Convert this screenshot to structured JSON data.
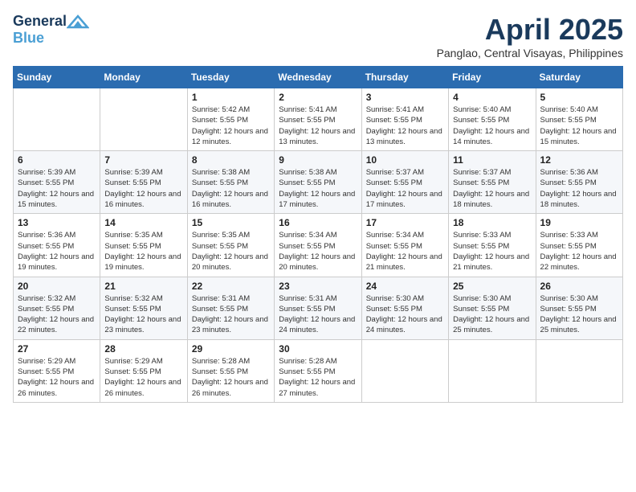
{
  "header": {
    "logo_line1": "General",
    "logo_line2": "Blue",
    "month_title": "April 2025",
    "location": "Panglao, Central Visayas, Philippines"
  },
  "weekdays": [
    "Sunday",
    "Monday",
    "Tuesday",
    "Wednesday",
    "Thursday",
    "Friday",
    "Saturday"
  ],
  "weeks": [
    [
      {
        "day": null,
        "info": null
      },
      {
        "day": null,
        "info": null
      },
      {
        "day": "1",
        "info": "Sunrise: 5:42 AM\nSunset: 5:55 PM\nDaylight: 12 hours and 12 minutes."
      },
      {
        "day": "2",
        "info": "Sunrise: 5:41 AM\nSunset: 5:55 PM\nDaylight: 12 hours and 13 minutes."
      },
      {
        "day": "3",
        "info": "Sunrise: 5:41 AM\nSunset: 5:55 PM\nDaylight: 12 hours and 13 minutes."
      },
      {
        "day": "4",
        "info": "Sunrise: 5:40 AM\nSunset: 5:55 PM\nDaylight: 12 hours and 14 minutes."
      },
      {
        "day": "5",
        "info": "Sunrise: 5:40 AM\nSunset: 5:55 PM\nDaylight: 12 hours and 15 minutes."
      }
    ],
    [
      {
        "day": "6",
        "info": "Sunrise: 5:39 AM\nSunset: 5:55 PM\nDaylight: 12 hours and 15 minutes."
      },
      {
        "day": "7",
        "info": "Sunrise: 5:39 AM\nSunset: 5:55 PM\nDaylight: 12 hours and 16 minutes."
      },
      {
        "day": "8",
        "info": "Sunrise: 5:38 AM\nSunset: 5:55 PM\nDaylight: 12 hours and 16 minutes."
      },
      {
        "day": "9",
        "info": "Sunrise: 5:38 AM\nSunset: 5:55 PM\nDaylight: 12 hours and 17 minutes."
      },
      {
        "day": "10",
        "info": "Sunrise: 5:37 AM\nSunset: 5:55 PM\nDaylight: 12 hours and 17 minutes."
      },
      {
        "day": "11",
        "info": "Sunrise: 5:37 AM\nSunset: 5:55 PM\nDaylight: 12 hours and 18 minutes."
      },
      {
        "day": "12",
        "info": "Sunrise: 5:36 AM\nSunset: 5:55 PM\nDaylight: 12 hours and 18 minutes."
      }
    ],
    [
      {
        "day": "13",
        "info": "Sunrise: 5:36 AM\nSunset: 5:55 PM\nDaylight: 12 hours and 19 minutes."
      },
      {
        "day": "14",
        "info": "Sunrise: 5:35 AM\nSunset: 5:55 PM\nDaylight: 12 hours and 19 minutes."
      },
      {
        "day": "15",
        "info": "Sunrise: 5:35 AM\nSunset: 5:55 PM\nDaylight: 12 hours and 20 minutes."
      },
      {
        "day": "16",
        "info": "Sunrise: 5:34 AM\nSunset: 5:55 PM\nDaylight: 12 hours and 20 minutes."
      },
      {
        "day": "17",
        "info": "Sunrise: 5:34 AM\nSunset: 5:55 PM\nDaylight: 12 hours and 21 minutes."
      },
      {
        "day": "18",
        "info": "Sunrise: 5:33 AM\nSunset: 5:55 PM\nDaylight: 12 hours and 21 minutes."
      },
      {
        "day": "19",
        "info": "Sunrise: 5:33 AM\nSunset: 5:55 PM\nDaylight: 12 hours and 22 minutes."
      }
    ],
    [
      {
        "day": "20",
        "info": "Sunrise: 5:32 AM\nSunset: 5:55 PM\nDaylight: 12 hours and 22 minutes."
      },
      {
        "day": "21",
        "info": "Sunrise: 5:32 AM\nSunset: 5:55 PM\nDaylight: 12 hours and 23 minutes."
      },
      {
        "day": "22",
        "info": "Sunrise: 5:31 AM\nSunset: 5:55 PM\nDaylight: 12 hours and 23 minutes."
      },
      {
        "day": "23",
        "info": "Sunrise: 5:31 AM\nSunset: 5:55 PM\nDaylight: 12 hours and 24 minutes."
      },
      {
        "day": "24",
        "info": "Sunrise: 5:30 AM\nSunset: 5:55 PM\nDaylight: 12 hours and 24 minutes."
      },
      {
        "day": "25",
        "info": "Sunrise: 5:30 AM\nSunset: 5:55 PM\nDaylight: 12 hours and 25 minutes."
      },
      {
        "day": "26",
        "info": "Sunrise: 5:30 AM\nSunset: 5:55 PM\nDaylight: 12 hours and 25 minutes."
      }
    ],
    [
      {
        "day": "27",
        "info": "Sunrise: 5:29 AM\nSunset: 5:55 PM\nDaylight: 12 hours and 26 minutes."
      },
      {
        "day": "28",
        "info": "Sunrise: 5:29 AM\nSunset: 5:55 PM\nDaylight: 12 hours and 26 minutes."
      },
      {
        "day": "29",
        "info": "Sunrise: 5:28 AM\nSunset: 5:55 PM\nDaylight: 12 hours and 26 minutes."
      },
      {
        "day": "30",
        "info": "Sunrise: 5:28 AM\nSunset: 5:55 PM\nDaylight: 12 hours and 27 minutes."
      },
      {
        "day": null,
        "info": null
      },
      {
        "day": null,
        "info": null
      },
      {
        "day": null,
        "info": null
      }
    ]
  ]
}
